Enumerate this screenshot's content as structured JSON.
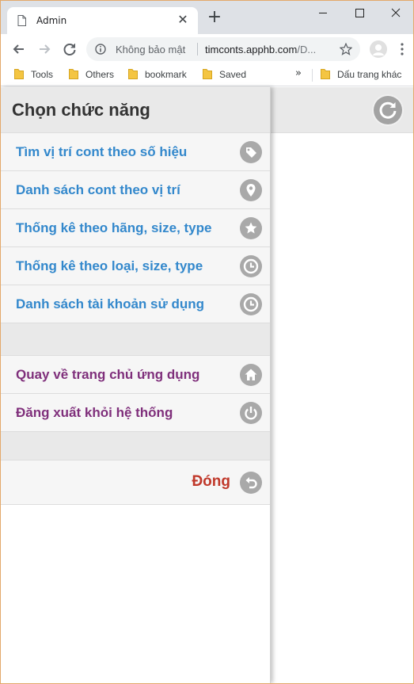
{
  "browser": {
    "tab_title": "Admin",
    "tab_close_glyph": "✕",
    "new_tab_glyph": "+",
    "security_label": "Không bảo mật",
    "url_host": "timconts.apphb.com",
    "url_path": "/D...",
    "bookmarks": [
      {
        "label": "Tools"
      },
      {
        "label": "Others"
      },
      {
        "label": "bookmark"
      },
      {
        "label": "Saved"
      }
    ],
    "bookmarks_more_glyph": "»",
    "other_bookmarks": "Dấu trang khác",
    "folder_color": "#f4c542"
  },
  "panel": {
    "title": "Chọn chức năng",
    "items": [
      {
        "label": "Tìm vị trí cont theo số hiệu",
        "icon": "tag-icon",
        "color": "#3388cc"
      },
      {
        "label": "Danh sách cont theo vị trí",
        "icon": "location-pin-icon",
        "color": "#3388cc"
      },
      {
        "label": "Thống kê theo hãng, size, type",
        "icon": "star-icon",
        "color": "#3388cc"
      },
      {
        "label": "Thống kê theo loại, size, type",
        "icon": "clock-icon",
        "color": "#3388cc"
      },
      {
        "label": "Danh sách tài khoản sử dụng",
        "icon": "clock-icon",
        "color": "#3388cc"
      }
    ],
    "system_items": [
      {
        "label": "Quay về trang chủ ứng dụng",
        "icon": "home-icon",
        "color": "#7f2f7b"
      },
      {
        "label": "Đăng xuất khỏi hệ thống",
        "icon": "power-icon",
        "color": "#7f2f7b"
      }
    ],
    "close_label": "Đóng",
    "close_color": "#c0392b",
    "close_icon": "back-arrow-icon"
  },
  "header": {
    "refresh_icon": "refresh-icon"
  }
}
